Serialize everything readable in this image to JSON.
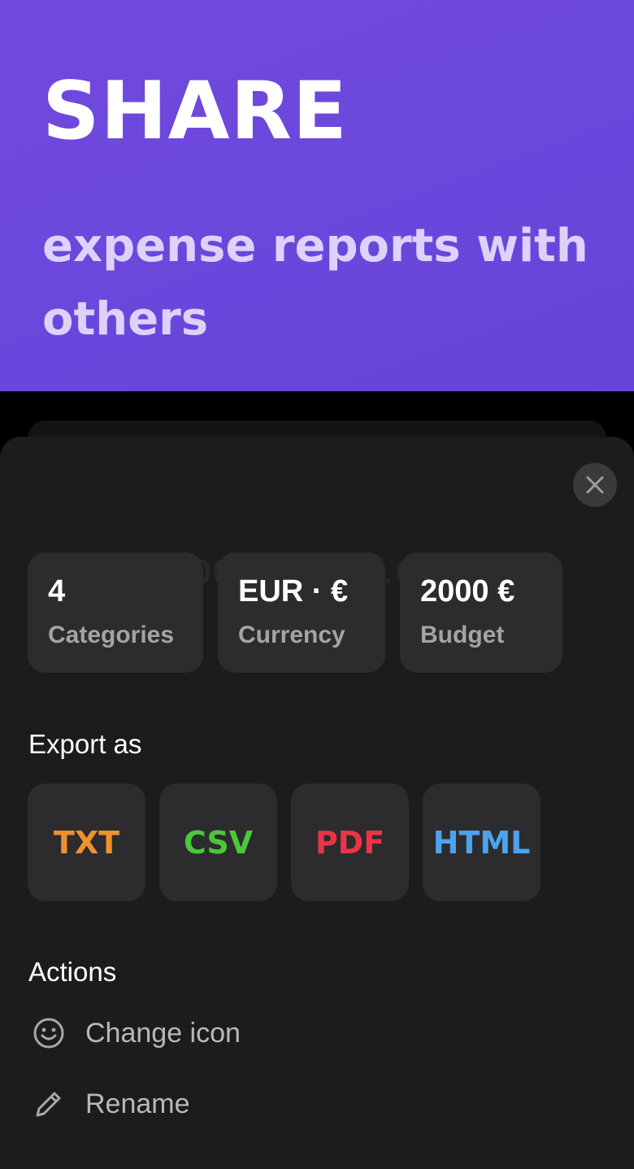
{
  "hero": {
    "title": "SHARE",
    "subtitle": "expense reports with others"
  },
  "watermark": "UpdateStar.com",
  "stats": [
    {
      "value": "4",
      "label": "Categories"
    },
    {
      "value": "EUR · €",
      "label": "Currency"
    },
    {
      "value": "2000 €",
      "label": "Budget"
    }
  ],
  "export": {
    "heading": "Export as",
    "formats": [
      {
        "label": "TXT",
        "color": "#f0912e"
      },
      {
        "label": "CSV",
        "color": "#4cc63a"
      },
      {
        "label": "PDF",
        "color": "#ec3448"
      },
      {
        "label": "HTML",
        "color": "#4da2ee"
      }
    ]
  },
  "actions": {
    "heading": "Actions",
    "items": [
      {
        "label": "Change icon",
        "icon": "smiley-icon"
      },
      {
        "label": "Rename",
        "icon": "pencil-icon"
      }
    ]
  },
  "colors": {
    "hero_bg": "#6a47dc",
    "sheet_bg": "#1c1c1e",
    "card_bg": "#2c2c2e"
  }
}
